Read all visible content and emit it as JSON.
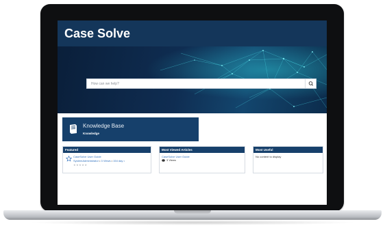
{
  "header": {
    "title": "Case Solve"
  },
  "search": {
    "placeholder": "How can we help?",
    "icon": "search-icon"
  },
  "knowledge_tile": {
    "title": "Knowledge Base",
    "subtitle": "Knowledge"
  },
  "panels": {
    "featured": {
      "title": "Featured",
      "article_title": "CaseSolve User Guide",
      "meta_author": "SystemAdministrator",
      "meta_views": "3 Views",
      "meta_age": "154 day",
      "rating_stars": "★★★★★",
      "rating_value": 0
    },
    "most_viewed": {
      "title": "Most Viewed Articles",
      "article_title": "CaseSolve User Guide",
      "views": "3 Views"
    },
    "most_useful": {
      "title": "Most Useful",
      "empty_text": "No content to display"
    }
  },
  "colors": {
    "header": "#14365a",
    "panel_header": "#17406b",
    "link": "#2d6fbd",
    "hero_accent": "#2fd4e0"
  }
}
